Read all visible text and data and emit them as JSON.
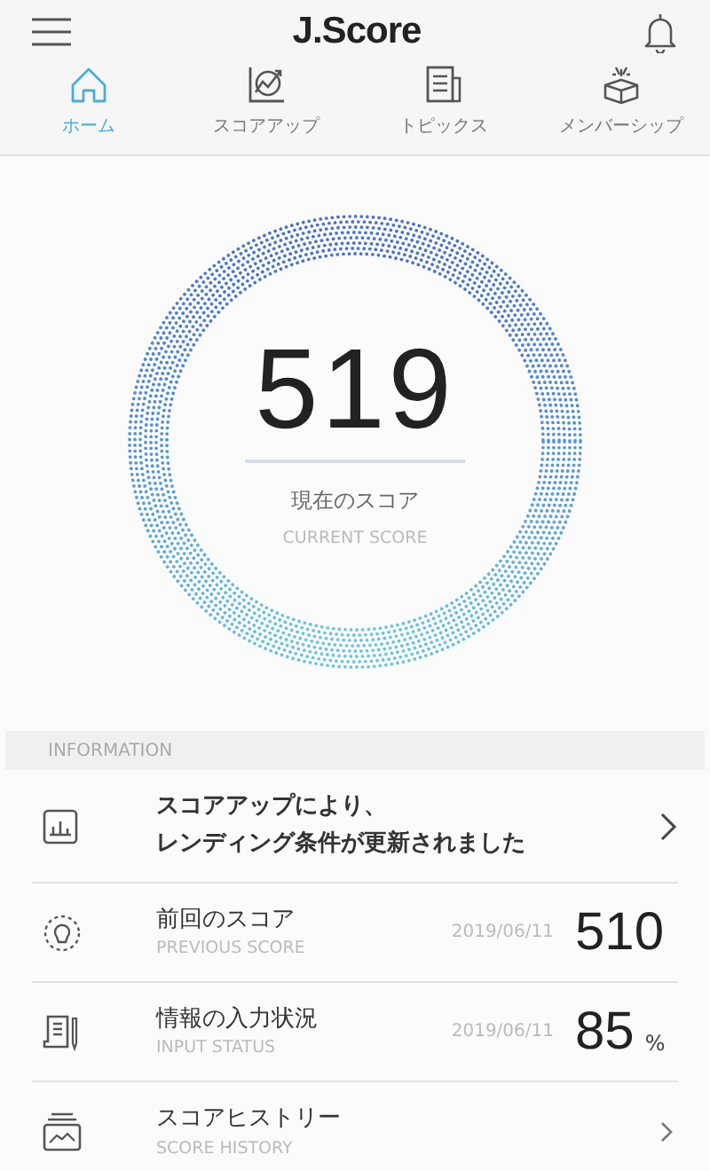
{
  "header": {
    "title": "J.Score"
  },
  "tabs": [
    {
      "label": "ホーム",
      "selected": true
    },
    {
      "label": "スコアアップ",
      "selected": false
    },
    {
      "label": "トピックス",
      "selected": false
    },
    {
      "label": "メンバーシップ",
      "selected": false
    }
  ],
  "score": {
    "value": "519",
    "label": "現在のスコア",
    "sublabel": "CURRENT SCORE"
  },
  "section_title": "INFORMATION",
  "notice": {
    "lines": [
      "スコアアップにより、",
      "レンディング条件が更新されました"
    ]
  },
  "rows": [
    {
      "kind": "stat",
      "title": "前回のスコア",
      "subtitle": "PREVIOUS SCORE",
      "date": "2019/06/11",
      "value": "510"
    },
    {
      "kind": "stat",
      "title": "情報の入力状況",
      "subtitle": "INPUT STATUS",
      "date": "2019/06/11",
      "value": "85",
      "unit": "%"
    },
    {
      "kind": "link",
      "title": "スコアヒストリー",
      "subtitle": "SCORE HISTORY"
    }
  ]
}
